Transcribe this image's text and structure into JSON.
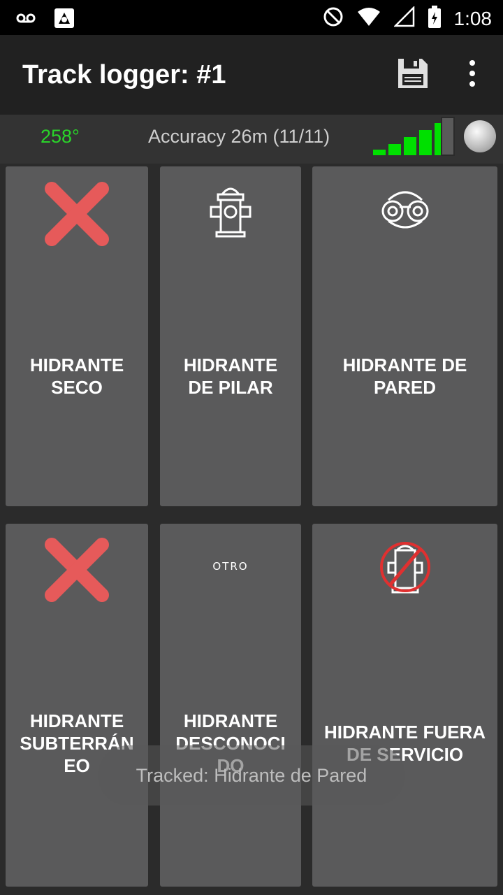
{
  "statusbar": {
    "time": "1:08",
    "icons": [
      "voicemail-icon",
      "app-notification-icon",
      "do-not-disturb-icon",
      "wifi-icon",
      "cell-signal-icon",
      "battery-charging-icon"
    ]
  },
  "appbar": {
    "title": "Track logger: #1",
    "actions": [
      "save-icon",
      "more-vert-icon"
    ]
  },
  "info": {
    "heading": "258°",
    "accuracy": "Accuracy 26m (11/11)",
    "signal_level": 0.83,
    "colors": {
      "heading": "#2ad42a",
      "signal": "#00e000"
    }
  },
  "tiles": [
    {
      "label": "HIDRANTE\nSECO",
      "icon": "red-x-icon"
    },
    {
      "label": "HIDRANTE\nDE PILAR",
      "icon": "pillar-hydrant-icon"
    },
    {
      "label": "HIDRANTE DE\nPARED",
      "icon": "wall-hydrant-icon"
    },
    {
      "label": "HIDRANTE\nSUBTERRÁN\nEO",
      "icon": "red-x-icon"
    },
    {
      "label": "HIDRANTE\nDESCONOCI\nDO",
      "icon": "otro-text",
      "icon_text": "OTRO"
    },
    {
      "label": "HIDRANTE FUERA\nDE SERVICIO",
      "icon": "hydrant-out-of-service-icon"
    }
  ],
  "toast": {
    "text": "Tracked: Hidrante de Pared"
  }
}
